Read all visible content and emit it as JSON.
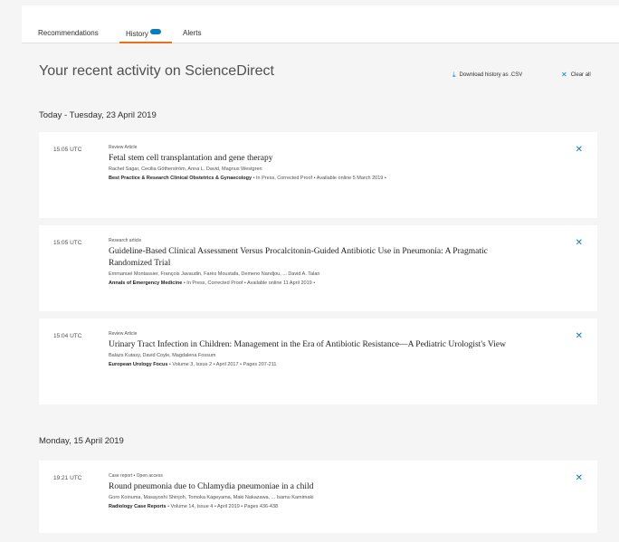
{
  "tabs": [
    {
      "label": "Recommendations"
    },
    {
      "label": "History",
      "badge": "new"
    },
    {
      "label": "Alerts"
    }
  ],
  "page_title": "Your recent activity on ScienceDirect",
  "actions": {
    "download": {
      "label": "Download history as .CSV",
      "icon": "download-icon"
    },
    "clear": {
      "label": "Clear all",
      "icon": "close-icon"
    }
  },
  "days": [
    {
      "heading": "Today - Tuesday, 23 April 2019",
      "items": [
        {
          "time": "15:05 UTC",
          "type": "Review Article",
          "title": "Fetal stem cell transplantation and gene therapy",
          "authors": "Rachel Sagar, Cecilia Götherström, Anna L. David, Magnus Westgren",
          "journal": "Best Practice & Research Clinical Obstetrics & Gynaecology",
          "details": " • In Press, Corrected Proof • Available online 5 March 2019 •"
        },
        {
          "time": "15:05 UTC",
          "type": "Research article",
          "title": "Guideline-Based Clinical Assessment Versus Procalcitonin-Guided Antibiotic Use in Pneumonia: A Pragmatic Randomized Trial",
          "authors": "Emmanuel Montassier, François Javaudin, Farès Moustafa, Demeno Nandjou, ... David A. Talan",
          "journal": "Annals of Emergency Medicine",
          "details": " • In Press, Corrected Proof • Available online 11 April 2019 •"
        },
        {
          "time": "15:04 UTC",
          "type": "Review Article",
          "title": "Urinary Tract Infection in Children: Management in the Era of Antibiotic Resistance—A Pediatric Urologist's View",
          "authors": "Balazs Kutasy, David Coyle, Magdalena Fossum",
          "journal": "European Urology Focus",
          "details": " • Volume 3, Issue 2 • April 2017 • Pages 207-211"
        }
      ]
    },
    {
      "heading": "Monday, 15 April 2019",
      "items": [
        {
          "time": "19:21 UTC",
          "type": "Case report • Open access",
          "title": "Round pneumonia due to Chlamydia pneumoniae in a child",
          "authors": "Goro Koinuma, Masayoshi Shinjoh, Tomoka Kageyama, Maki Nakazawa, ... Isamu Kamimaki",
          "journal": "Radiology Case Reports",
          "details": " • Volume 14, Issue 4 • April 2019 • Pages 436-438"
        }
      ]
    }
  ],
  "colors": {
    "accent": "#0c7dbb",
    "tab_underline": "#e9711c"
  }
}
